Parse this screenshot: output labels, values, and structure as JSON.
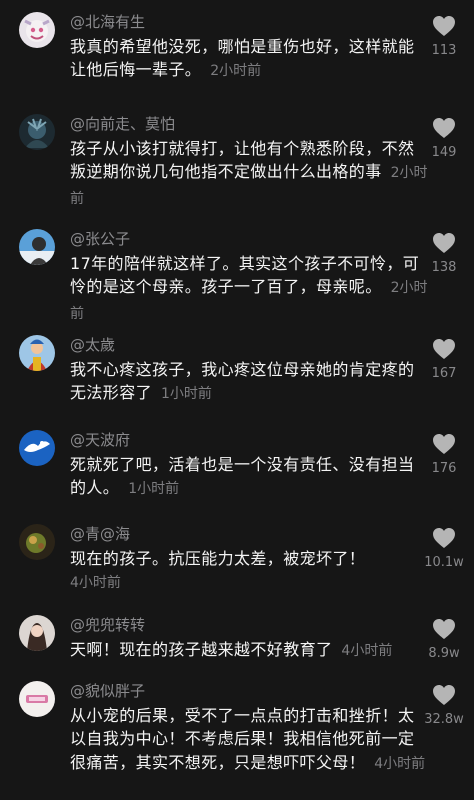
{
  "comments": [
    {
      "username": "@北海有生",
      "text": "我真的希望他没死，哪怕是重伤也好，这样就能让他后悔一辈子。",
      "time": "2小时前",
      "likes": "113"
    },
    {
      "username": "@向前走、莫怕",
      "text": "孩子从小该打就得打，让他有个熟悉阶段，不然叛逆期你说几句他指不定做出什么出格的事",
      "time": "2小时前",
      "likes": "149"
    },
    {
      "username": "@张公子",
      "text": "17年的陪伴就这样了。其实这个孩子不可怜，可怜的是这个母亲。孩子一了百了，母亲呢。",
      "time": "2小时前",
      "likes": "138"
    },
    {
      "username": "@太歲",
      "text": "我不心疼这孩子，我心疼这位母亲她的肯定疼的无法形容了",
      "time": "1小时前",
      "likes": "167"
    },
    {
      "username": "@天波府",
      "text": "死就死了吧，活着也是一个没有责任、没有担当的人。",
      "time": "1小时前",
      "likes": "176"
    },
    {
      "username": "@青@海",
      "text": "现在的孩子。抗压能力太差，被宠坏了！",
      "time": "4小时前",
      "likes": "10.1w"
    },
    {
      "username": "@兜兜转转",
      "text": "天啊！现在的孩子越来越不好教育了",
      "time": "4小时前",
      "likes": "8.9w"
    },
    {
      "username": "@貌似胖子",
      "text": "从小宠的后果，受不了一点点的打击和挫折！太以自我为中心！不考虑后果！我相信他死前一定很痛苦，其实不想死，只是想吓吓父母！",
      "time": "4小时前",
      "likes": "32.8w"
    }
  ],
  "like_icon": "heart-icon",
  "colors": {
    "background": "#161616",
    "text": "#f4f4f4",
    "muted": "#8b8b8e",
    "heart": "#b5b5b5"
  }
}
